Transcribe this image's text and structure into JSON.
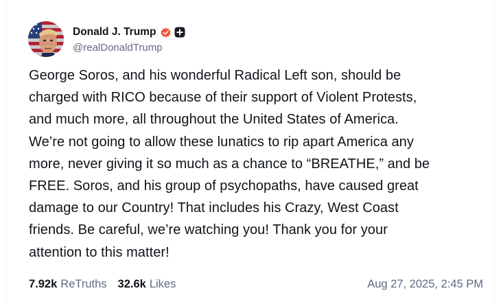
{
  "author": {
    "display_name": "Donald J. Trump",
    "handle": "@realDonaldTrump",
    "avatar_icon": "avatar-flag-portrait",
    "verified_icon": "verified-badge-icon",
    "verified_color": "#f0543c",
    "plus_icon": "plus-badge-icon"
  },
  "post": {
    "lines": [
      "George Soros, and his wonderful Radical Left son, should be",
      "charged with RICO because of their support of Violent Protests,",
      "and much more, all throughout the United States of America.",
      "We’re not going to allow these lunatics to rip apart America any",
      "more, never giving it so much as a chance to “BREATHE,” and be",
      "FREE. Soros, and his group of psychopaths, have caused great",
      "damage to our Country! That includes his Crazy, West Coast",
      "friends. Be careful, we’re watching you! Thank you for your",
      "attention to this matter!"
    ]
  },
  "stats": {
    "retruths_count": "7.92k",
    "retruths_label": "ReTruths",
    "likes_count": "32.6k",
    "likes_label": "Likes"
  },
  "timestamp": "Aug 27, 2025, 2:45 PM"
}
